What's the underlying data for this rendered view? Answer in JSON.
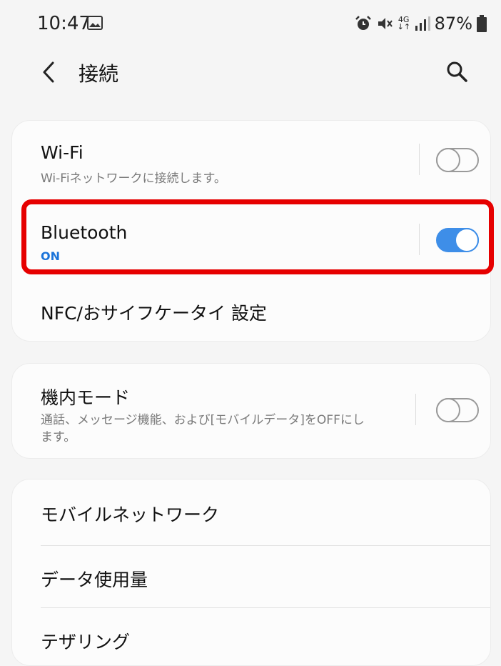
{
  "status_bar": {
    "time": "10:47",
    "battery_percent": "87%",
    "network_label": "4G",
    "icons": [
      "gallery-icon",
      "alarm-icon",
      "mute-icon",
      "data-arrows-icon",
      "signal-icon",
      "battery-icon"
    ]
  },
  "header": {
    "title": "接続",
    "back_icon": "chevron-left-icon",
    "search_icon": "search-icon"
  },
  "settings": {
    "wifi": {
      "title": "Wi-Fi",
      "subtitle": "Wi-Fiネットワークに接続します。",
      "enabled": false
    },
    "bluetooth": {
      "title": "Bluetooth",
      "subtitle": "ON",
      "enabled": true
    },
    "nfc": {
      "title": "NFC/おサイフケータイ 設定"
    },
    "airplane": {
      "title": "機内モード",
      "subtitle_line1": "通話、メッセージ機能、および[モバイルデータ]をOFFにし",
      "subtitle_line2": "ます。",
      "enabled": false
    },
    "mobile_network": {
      "title": "モバイルネットワーク"
    },
    "data_usage": {
      "title": "データ使用量"
    },
    "tethering": {
      "title": "テザリング"
    }
  },
  "colors": {
    "accent": "#3e8ee8",
    "highlight": "#e60000",
    "on_text": "#1a73d9"
  }
}
